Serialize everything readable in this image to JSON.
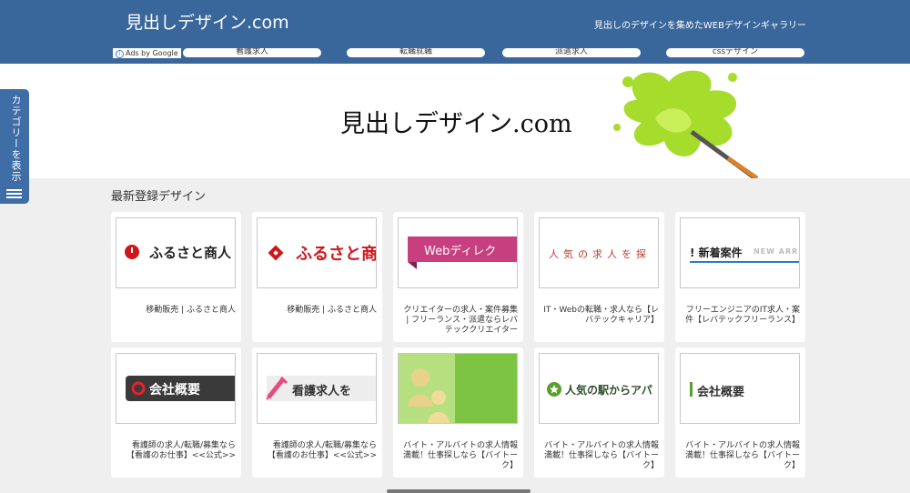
{
  "header": {
    "site_title": "見出しデザイン.com",
    "tagline": "見出しのデザインを集めたWEBデザインギャラリー",
    "ads_label": "Ads by Google",
    "nav": [
      "看護求人",
      "転職就職",
      "派遣求人",
      "cssデザイン"
    ],
    "bg_color": "#3a679b"
  },
  "hero": {
    "title": "見出しデザイン.com",
    "paint_icon": "paint-splash-brush-icon"
  },
  "category_tab": {
    "label": "カテゴリーを表示",
    "icon": "hamburger-menu-icon"
  },
  "section": {
    "title": "最新登録デザイン"
  },
  "cards": [
    {
      "thumb_text": "ふるさと商人",
      "caption": "移動販売 | ふるさと商人"
    },
    {
      "thumb_text": "ふるさと商",
      "caption": "移動販売 | ふるさと商人"
    },
    {
      "thumb_text": "Webディレク",
      "caption": "クリエイターの求人・案件募集 | フリーランス・派遣ならレバ テッククリエイター"
    },
    {
      "thumb_text": "人気の求人を探",
      "caption": "IT・Webの転職・求人なら【レ バテックキャリア】"
    },
    {
      "thumb_text": "新着案件",
      "thumb_sub": "NEW ARRI",
      "caption": "フリーエンジニアのIT求人・案 件【レバテックフリーランス】"
    },
    {
      "thumb_text": "会社概要",
      "caption": "看護師の求人/転職/募集なら 【看護のお仕事】<<公式>>"
    },
    {
      "thumb_text": "看護求人を",
      "caption": "看護師の求人/転職/募集なら 【看護のお仕事】<<公式>>"
    },
    {
      "thumb_text": "",
      "caption": "バイト・アルバイトの求人情報 満載！仕事探しなら【バイトー ク】"
    },
    {
      "thumb_text": "人気の駅からアパ",
      "caption": "バイト・アルバイトの求人情報 満載！仕事探しなら【バイトー ク】"
    },
    {
      "thumb_text": "会社概要",
      "caption": "バイト・アルバイトの求人情報 満載！仕事探しなら【バイトー ク】"
    }
  ]
}
